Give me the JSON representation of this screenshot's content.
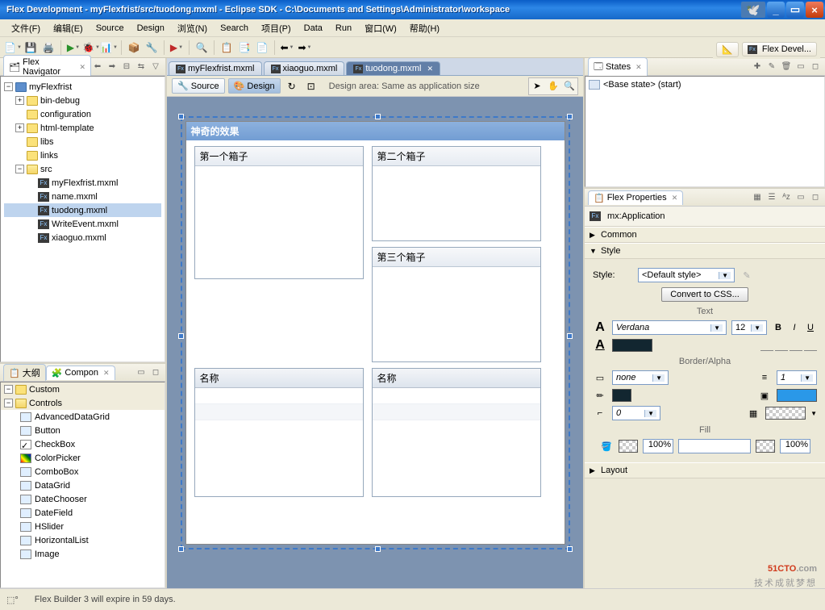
{
  "titlebar": "Flex Development - myFlexfrist/src/tuodong.mxml - Eclipse SDK - C:\\Documents and Settings\\Administrator\\workspace",
  "menu": [
    "文件(F)",
    "编辑(E)",
    "Source",
    "Design",
    "浏览(N)",
    "Search",
    "项目(P)",
    "Data",
    "Run",
    "窗口(W)",
    "帮助(H)"
  ],
  "perspective_label": "Flex Devel...",
  "navigator": {
    "title": "Flex Navigator",
    "project": "myFlexfrist",
    "folders": [
      "bin-debug",
      "configuration",
      "html-template",
      "libs",
      "links"
    ],
    "src_label": "src",
    "src_files": [
      "myFlexfrist.mxml",
      "name.mxml",
      "tuodong.mxml",
      "WriteEvent.mxml",
      "xiaoguo.mxml"
    ],
    "selected": "tuodong.mxml"
  },
  "outline_tab": "大纲",
  "components": {
    "title": "Compon",
    "custom": "Custom",
    "controls": "Controls",
    "items": [
      "AdvancedDataGrid",
      "Button",
      "CheckBox",
      "ColorPicker",
      "ComboBox",
      "DataGrid",
      "DateChooser",
      "DateField",
      "HSlider",
      "HorizontalList",
      "Image"
    ]
  },
  "editor_tabs": [
    "myFlexfrist.mxml",
    "xiaoguo.mxml",
    "tuodong.mxml"
  ],
  "active_tab": "tuodong.mxml",
  "source_btn": "Source",
  "design_btn": "Design",
  "design_area_msg": "Design area: Same as application size",
  "canvas": {
    "panel_title": "神奇的效果",
    "box1": "第一个箱子",
    "box2": "第二个箱子",
    "box3": "第三个箱子",
    "col_label": "名称"
  },
  "states": {
    "title": "States",
    "base": "<Base state> (start)"
  },
  "properties": {
    "title": "Flex Properties",
    "component": "mx:Application",
    "common": "Common",
    "style": "Style",
    "style_label": "Style:",
    "default_style": "<Default style>",
    "convert": "Convert to CSS...",
    "text": "Text",
    "font": "Verdana",
    "size": "12",
    "border": "Border/Alpha",
    "border_style": "none",
    "border_w": "1",
    "corner": "0",
    "fill": "Fill",
    "pct": "100%",
    "layout": "Layout"
  },
  "statusbar_text": "Flex Builder 3 will expire in 59 days.",
  "watermark": {
    "brand": "51CTO",
    "suffix": ".com",
    "tagline": "技术成就梦想"
  }
}
